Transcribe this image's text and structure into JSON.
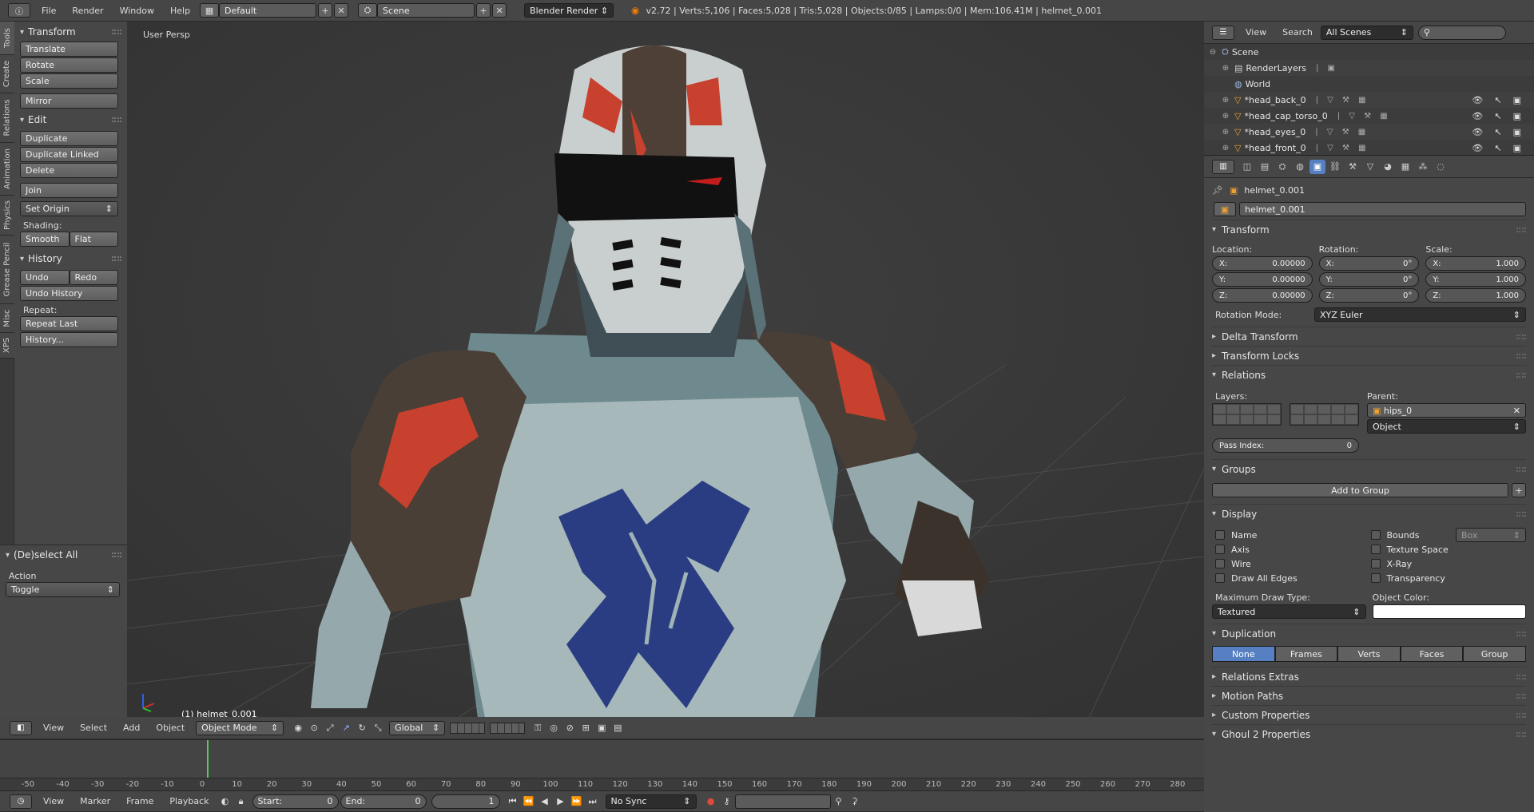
{
  "topbar": {
    "menus": [
      "File",
      "Render",
      "Window",
      "Help"
    ],
    "layout": "Default",
    "scene": "Scene",
    "engine": "Blender Render",
    "stats": "v2.72 | Verts:5,106 | Faces:5,028 | Tris:5,028 | Objects:0/85 | Lamps:0/0 | Mem:106.41M | helmet_0.001"
  },
  "vtabs": [
    "Tools",
    "Create",
    "Relations",
    "Animation",
    "Physics",
    "Grease Pencil",
    "Misc",
    "XPS"
  ],
  "toolshelf": {
    "transform_title": "Transform",
    "transform_buttons": [
      "Translate",
      "Rotate",
      "Scale"
    ],
    "mirror": "Mirror",
    "edit_title": "Edit",
    "edit_buttons": [
      "Duplicate",
      "Duplicate Linked",
      "Delete"
    ],
    "join": "Join",
    "set_origin": "Set Origin",
    "shading_label": "Shading:",
    "smooth": "Smooth",
    "flat": "Flat",
    "history_title": "History",
    "undo": "Undo",
    "redo": "Redo",
    "undo_history": "Undo History",
    "repeat_label": "Repeat:",
    "repeat_last": "Repeat Last",
    "history_btn": "History..."
  },
  "operator": {
    "title": "(De)select All",
    "action_label": "Action",
    "action_value": "Toggle"
  },
  "viewport": {
    "label": "User Persp",
    "object": "(1) helmet_0.001"
  },
  "view3d_header": {
    "menus": [
      "View",
      "Select",
      "Add",
      "Object"
    ],
    "mode": "Object Mode",
    "orientation": "Global"
  },
  "timeline": {
    "ticks": [
      "-50",
      "-40",
      "-30",
      "-20",
      "-10",
      "0",
      "10",
      "20",
      "30",
      "40",
      "50",
      "60",
      "70",
      "80",
      "90",
      "100",
      "110",
      "120",
      "130",
      "140",
      "150",
      "160",
      "170",
      "180",
      "190",
      "200",
      "210",
      "220",
      "230",
      "240",
      "250",
      "260",
      "270",
      "280"
    ],
    "menus": [
      "View",
      "Marker",
      "Frame",
      "Playback"
    ],
    "start_label": "Start:",
    "start_value": "0",
    "end_label": "End:",
    "end_value": "0",
    "current": "1",
    "sync": "No Sync"
  },
  "outliner": {
    "menus": [
      "View",
      "Search"
    ],
    "filter": "All Scenes",
    "rows": [
      {
        "name": "Scene",
        "indent": 0
      },
      {
        "name": "RenderLayers",
        "indent": 1
      },
      {
        "name": "World",
        "indent": 1
      },
      {
        "name": "*head_back_0",
        "indent": 1
      },
      {
        "name": "*head_cap_torso_0",
        "indent": 1
      },
      {
        "name": "*head_eyes_0",
        "indent": 1
      },
      {
        "name": "*head_front_0",
        "indent": 1
      }
    ]
  },
  "props": {
    "breadcrumb": "helmet_0.001",
    "object_name": "helmet_0.001",
    "transform_title": "Transform",
    "location_label": "Location:",
    "rotation_label": "Rotation:",
    "scale_label": "Scale:",
    "loc": [
      {
        "axis": "X:",
        "val": "0.00000"
      },
      {
        "axis": "Y:",
        "val": "0.00000"
      },
      {
        "axis": "Z:",
        "val": "0.00000"
      }
    ],
    "rot": [
      {
        "axis": "X:",
        "val": "0°"
      },
      {
        "axis": "Y:",
        "val": "0°"
      },
      {
        "axis": "Z:",
        "val": "0°"
      }
    ],
    "scl": [
      {
        "axis": "X:",
        "val": "1.000"
      },
      {
        "axis": "Y:",
        "val": "1.000"
      },
      {
        "axis": "Z:",
        "val": "1.000"
      }
    ],
    "rotation_mode_label": "Rotation Mode:",
    "rotation_mode": "XYZ Euler",
    "delta_transform": "Delta Transform",
    "transform_locks": "Transform Locks",
    "relations_title": "Relations",
    "layers_label": "Layers:",
    "parent_label": "Parent:",
    "parent": "hips_0",
    "parent_type": "Object",
    "pass_index_label": "Pass Index:",
    "pass_index": "0",
    "groups_title": "Groups",
    "add_to_group": "Add to Group",
    "display_title": "Display",
    "display_left": [
      "Name",
      "Axis",
      "Wire",
      "Draw All Edges"
    ],
    "display_right": [
      "Bounds",
      "Texture Space",
      "X-Ray",
      "Transparency"
    ],
    "bounds_type": "Box",
    "max_draw_label": "Maximum Draw Type:",
    "max_draw": "Textured",
    "object_color_label": "Object Color:",
    "duplication_title": "Duplication",
    "dup_modes": [
      "None",
      "Frames",
      "Verts",
      "Faces",
      "Group"
    ],
    "relations_extras": "Relations Extras",
    "motion_paths": "Motion Paths",
    "custom_properties": "Custom Properties",
    "ghoul2": "Ghoul 2 Properties"
  }
}
